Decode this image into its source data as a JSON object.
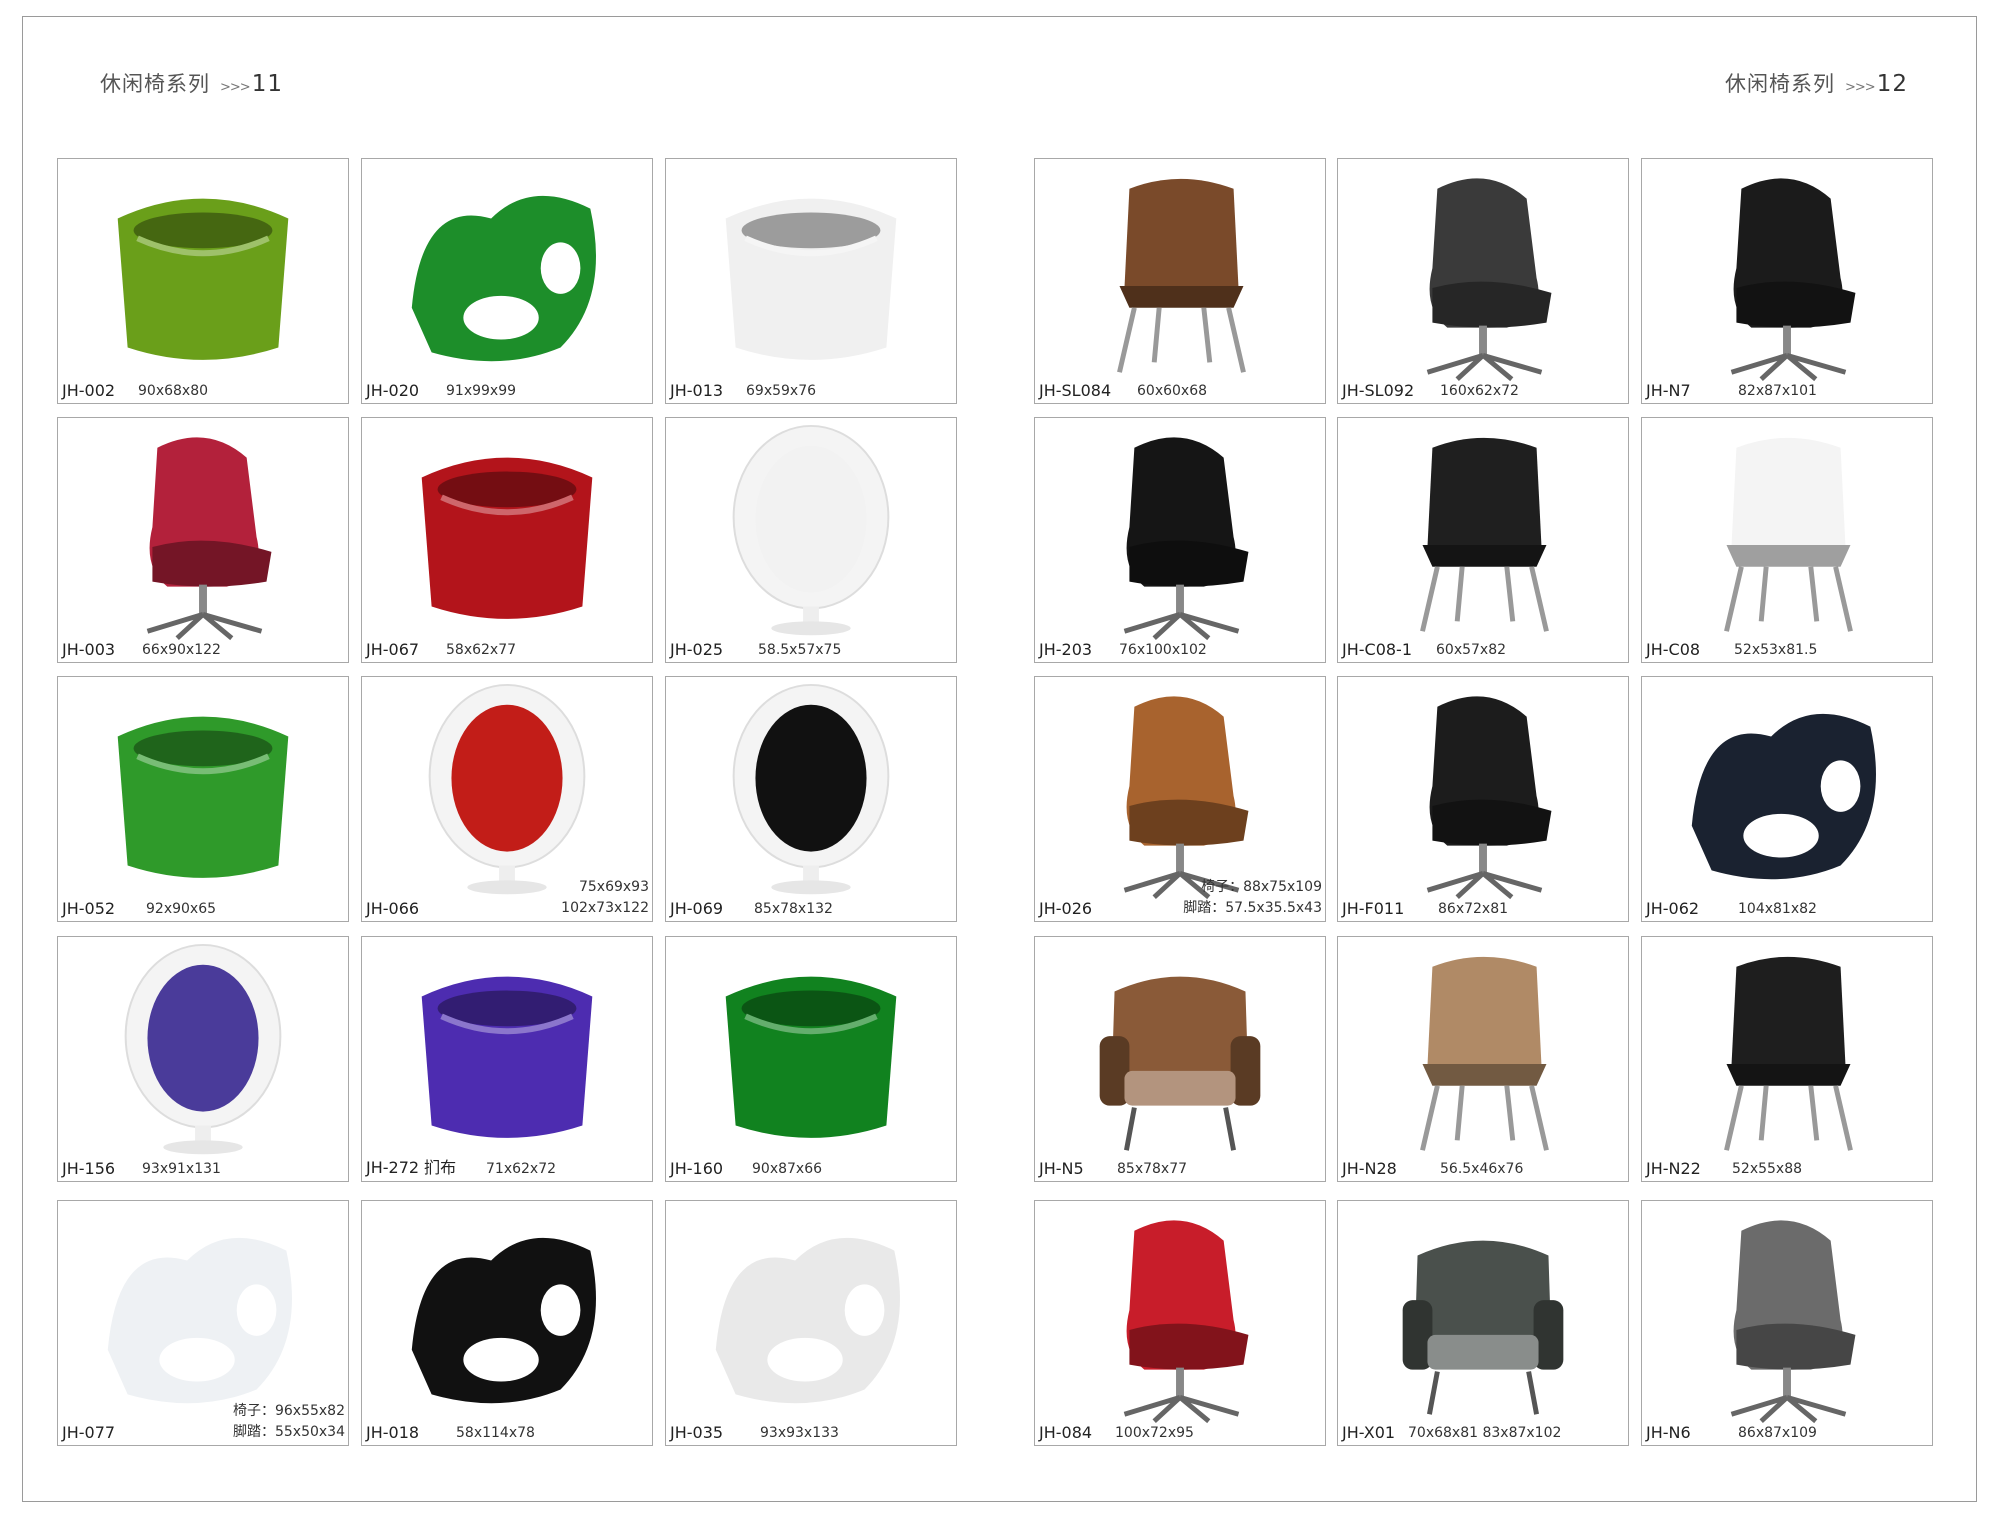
{
  "left_page": {
    "series": "休闲椅系列",
    "arrows": ">>>",
    "number": "11",
    "items": [
      {
        "code": "JH-002",
        "dims": "90x68x80",
        "color": "#6a9f1a"
      },
      {
        "code": "JH-020",
        "dims": "91x99x99",
        "color": "#1d8e2a"
      },
      {
        "code": "JH-013",
        "dims": "69x59x76",
        "color": "#f0f0f0"
      },
      {
        "code": "JH-003",
        "dims": "66x90x122",
        "color": "#b3213b"
      },
      {
        "code": "JH-067",
        "dims": "58x62x77",
        "color": "#b3141b"
      },
      {
        "code": "JH-025",
        "dims": "58.5x57x75",
        "color": "#f2f2f2"
      },
      {
        "code": "JH-052",
        "dims": "92x90x65",
        "color": "#2f9a2a"
      },
      {
        "code": "JH-066",
        "dims_lines": [
          "75x69x93",
          "102x73x122"
        ],
        "color": "#c21d18"
      },
      {
        "code": "JH-069",
        "dims": "85x78x132",
        "color": "#111111"
      },
      {
        "code": "JH-156",
        "dims": "93x91x131",
        "color": "#4a3b9a"
      },
      {
        "code": "JH-272 扪布",
        "dims": "71x62x72",
        "color": "#4d2cb0"
      },
      {
        "code": "JH-160",
        "dims": "90x87x66",
        "color": "#11821f"
      },
      {
        "code": "JH-077",
        "dims_lines": [
          "椅子：96x55x82",
          "脚踏：55x50x34"
        ],
        "color": "#eef1f4"
      },
      {
        "code": "JH-018",
        "dims": "58x114x78",
        "color": "#111111"
      },
      {
        "code": "JH-035",
        "dims": "93x93x133",
        "color": "#e9e9e9"
      }
    ]
  },
  "right_page": {
    "series": "休闲椅系列",
    "arrows": ">>>",
    "number": "12",
    "items": [
      {
        "code": "JH-SL084",
        "dims": "60x60x68",
        "color": "#7a4a2a"
      },
      {
        "code": "JH-SL092",
        "dims": "160x62x72",
        "color": "#3a3a3a"
      },
      {
        "code": "JH-N7",
        "dims": "82x87x101",
        "color": "#1b1b1b"
      },
      {
        "code": "JH-203",
        "dims": "76x100x102",
        "color": "#151515"
      },
      {
        "code": "JH-C08-1",
        "dims": "60x57x82",
        "color": "#1f1f1f"
      },
      {
        "code": "JH-C08",
        "dims": "52x53x81.5",
        "color": "#f4f4f4"
      },
      {
        "code": "JH-026",
        "dims_lines": [
          "椅子：88x75x109",
          "脚踏：57.5x35.5x43"
        ],
        "color": "#a8632e"
      },
      {
        "code": "JH-F011",
        "dims": "86x72x81",
        "color": "#1c1c1c"
      },
      {
        "code": "JH-062",
        "dims": "104x81x82",
        "color": "#1a2230"
      },
      {
        "code": "JH-N5",
        "dims": "85x78x77",
        "color": "#8a5a38"
      },
      {
        "code": "JH-N28",
        "dims": "56.5x46x76",
        "color": "#b08a66"
      },
      {
        "code": "JH-N22",
        "dims": "52x55x88",
        "color": "#1e1e1e"
      },
      {
        "code": "JH-084",
        "dims": "100x72x95",
        "color": "#c81d2a"
      },
      {
        "code": "JH-X01",
        "dims": "70x68x81  83x87x102",
        "color": "#4a504c"
      },
      {
        "code": "JH-N6",
        "dims": "86x87x109",
        "color": "#6b6b6b"
      }
    ]
  }
}
